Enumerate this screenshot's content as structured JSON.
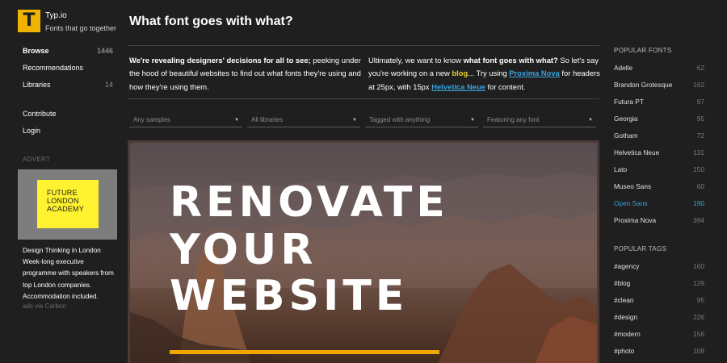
{
  "brand": {
    "logo_letter": "T",
    "name": "Typ.io",
    "tagline": "Fonts that go together"
  },
  "nav": [
    {
      "label": "Browse",
      "count": "1446"
    },
    {
      "label": "Recommendations",
      "count": ""
    },
    {
      "label": "Libraries",
      "count": "14"
    },
    {
      "label": "Contribute",
      "count": ""
    },
    {
      "label": "Login",
      "count": ""
    }
  ],
  "advert": {
    "label": "ADVERT",
    "logo_lines": [
      "FUTURE",
      "LONDON",
      "ACADEMY"
    ],
    "text": "Design Thinking in London Week-long executive programme with speakers from top London companies. Accommodation included.",
    "via": "ads via Carbon"
  },
  "page_title": "What font goes with what?",
  "intro_left": {
    "bold": "We're revealing designers' decisions for all to see;",
    "rest": " peeking under the hood of beautiful websites to find out what fonts they're using and how they're using them."
  },
  "intro_right": {
    "p1": "Ultimately, we want to know ",
    "bold": "what font goes with what?",
    "p2": " So let's say you're working on a new ",
    "blog": "blog",
    "p3": "... Try using ",
    "font1": "Proxima Nova",
    "p4": " for headers at 25px, with 15px ",
    "font2": "Helvetica Neue",
    "p5": " for content."
  },
  "filters": [
    {
      "value": "Any samples"
    },
    {
      "value": "All libraries"
    },
    {
      "value": "Tagged with anything"
    },
    {
      "value": "Featuring any font"
    }
  ],
  "sample": {
    "lines": [
      "RENOVATE",
      "YOUR",
      "WEBSITE"
    ]
  },
  "popular_fonts": {
    "heading": "POPULAR FONTS",
    "items": [
      {
        "name": "Adelle",
        "count": "62"
      },
      {
        "name": "Brandon Grotesque",
        "count": "162"
      },
      {
        "name": "Futura PT",
        "count": "97"
      },
      {
        "name": "Georgia",
        "count": "95"
      },
      {
        "name": "Gotham",
        "count": "72"
      },
      {
        "name": "Helvetica Neue",
        "count": "131"
      },
      {
        "name": "Lato",
        "count": "150"
      },
      {
        "name": "Museo Sans",
        "count": "60"
      },
      {
        "name": "Open Sans",
        "count": "190"
      },
      {
        "name": "Proxima Nova",
        "count": "394"
      }
    ]
  },
  "popular_tags": {
    "heading": "POPULAR TAGS",
    "items": [
      {
        "name": "#agency",
        "count": "160"
      },
      {
        "name": "#blog",
        "count": "129"
      },
      {
        "name": "#clean",
        "count": "95"
      },
      {
        "name": "#design",
        "count": "226"
      },
      {
        "name": "#modern",
        "count": "156"
      },
      {
        "name": "#photo",
        "count": "108"
      }
    ]
  },
  "colors": {
    "accent": "#f0b400",
    "link": "#39a3db",
    "highlight": "#e6d22a",
    "background": "#1f1f1f"
  }
}
